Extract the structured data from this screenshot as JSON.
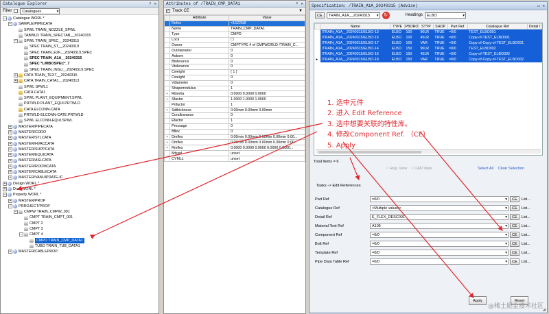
{
  "catalogue": {
    "title": "Catalogue Explorer",
    "filter_label": "Filter",
    "filter_value": "Catalogues",
    "nodes": [
      {
        "d": 0,
        "exp": "−",
        "icon": "world",
        "label": "Catalogue WORL *"
      },
      {
        "d": 1,
        "exp": "−",
        "icon": "world",
        "label": "SAMPLE/PIPECATA"
      },
      {
        "d": 2,
        "exp": "",
        "icon": "doc",
        "label": "SPWL TRAIN_NOZZLE_SPWL"
      },
      {
        "d": 2,
        "exp": "",
        "icon": "doc",
        "label": "TABWLD TRAIN_SPECTAB__20240315"
      },
      {
        "d": 2,
        "exp": "−",
        "icon": "doc",
        "label": "SPWL TRAIN_SPEC__20240315"
      },
      {
        "d": 3,
        "exp": "",
        "icon": "doc",
        "label": "SPEC TRAIN_ST__20240319"
      },
      {
        "d": 3,
        "exp": "",
        "icon": "doc",
        "label": "SPEC TRAIN_E2F__20240319.SPEC"
      },
      {
        "d": 3,
        "exp": "",
        "icon": "doc",
        "label": "SPEC TRAIN_A1A__20240315",
        "bold": true
      },
      {
        "d": 3,
        "exp": "",
        "icon": "doc",
        "label": "SPEC *LIMBOSPEC*_7",
        "bold": true
      },
      {
        "d": 3,
        "exp": "",
        "icon": "doc",
        "label": "SPEC TRAIN_INSU__20240319.SPEC"
      },
      {
        "d": 2,
        "exp": "+",
        "icon": "folder",
        "label": "CATA TRAIN_TEXT__20240315"
      },
      {
        "d": 2,
        "exp": "+",
        "icon": "folder",
        "label": "CATA TRAIN_CATA1__20240313"
      },
      {
        "d": 2,
        "exp": "",
        "icon": "doc",
        "label": "SPWL SPWL1"
      },
      {
        "d": 2,
        "exp": "",
        "icon": "folder",
        "label": "CATA CATA1"
      },
      {
        "d": 2,
        "exp": "",
        "icon": "doc",
        "label": "SPWL PLANT_EQUIPMENT.SPWL"
      },
      {
        "d": 2,
        "exp": "",
        "icon": "doc",
        "label": "PRTWLD PLANT_EQUI.PRTWLD"
      },
      {
        "d": 2,
        "exp": "",
        "icon": "folder",
        "label": "CATA ELCONN-CATA"
      },
      {
        "d": 2,
        "exp": "",
        "icon": "doc",
        "label": "PRTWLD ELCONN-CATE.PRTWLD"
      },
      {
        "d": 2,
        "exp": "",
        "icon": "doc",
        "label": "SPWL ELCONN-EQUI.SPWL"
      },
      {
        "d": 1,
        "exp": "+",
        "icon": "world",
        "label": "MASTER/PIPECATA"
      },
      {
        "d": 1,
        "exp": "+",
        "icon": "world",
        "label": "MASTER/CODO"
      },
      {
        "d": 1,
        "exp": "+",
        "icon": "world",
        "label": "MASTER/STLCATA"
      },
      {
        "d": 1,
        "exp": "+",
        "icon": "world",
        "label": "MASTER/HVACCATA"
      },
      {
        "d": 1,
        "exp": "+",
        "icon": "world",
        "label": "MASTER/SUPPCATA"
      },
      {
        "d": 1,
        "exp": "+",
        "icon": "world",
        "label": "MASTER/EQUICATA"
      },
      {
        "d": 1,
        "exp": "+",
        "icon": "world",
        "label": "MASTER/ASLCATA"
      },
      {
        "d": 1,
        "exp": "+",
        "icon": "world",
        "label": "MASTER/ROOMCATA"
      },
      {
        "d": 1,
        "exp": "+",
        "icon": "world",
        "label": "MASTER/CABLECATA"
      },
      {
        "d": 1,
        "exp": "+",
        "icon": "world",
        "label": "MASTER/VANUIPDATE-IC"
      },
      {
        "d": 0,
        "exp": "+",
        "icon": "world",
        "label": "Design WORL *"
      },
      {
        "d": 0,
        "exp": "+",
        "icon": "world",
        "label": "Draft WORL *"
      },
      {
        "d": 0,
        "exp": "−",
        "icon": "world",
        "label": "Property WORL *"
      },
      {
        "d": 1,
        "exp": "+",
        "icon": "world",
        "label": "MASTER/PROP"
      },
      {
        "d": 1,
        "exp": "−",
        "icon": "world",
        "label": "PRROJECT/PROP"
      },
      {
        "d": 2,
        "exp": "−",
        "icon": "doc",
        "label": "CMPW TRAIN_CMPW_001"
      },
      {
        "d": 3,
        "exp": "",
        "icon": "doc",
        "label": "CMPT TRAIN_CMPT_001"
      },
      {
        "d": 3,
        "exp": "",
        "icon": "doc",
        "label": "CMPT 2"
      },
      {
        "d": 3,
        "exp": "",
        "icon": "doc",
        "label": "CMPT 3"
      },
      {
        "d": 3,
        "exp": "−",
        "icon": "doc",
        "label": "CMPT 4"
      },
      {
        "d": 4,
        "exp": "",
        "icon": "doc",
        "label": "CMPD TRAIN_CMP_DATA1",
        "sel": true
      },
      {
        "d": 4,
        "exp": "",
        "icon": "doc",
        "label": "TUBD TRAIN_TUB_DATA1"
      },
      {
        "d": 1,
        "exp": "+",
        "icon": "world",
        "label": "MASTER/CABLEPROP"
      }
    ]
  },
  "attributes": {
    "title": "Attributes of /TRAIN_CMP_DATA1",
    "track_label": "Track CE",
    "col_attribute": "Attribute",
    "col_value": "Value",
    "rows": [
      {
        "exp": "",
        "a": "Refno",
        "v": "=15225/8",
        "sel": true
      },
      {
        "exp": "",
        "a": "Name",
        "v": "TRAIN_CMP_DATA1"
      },
      {
        "exp": "",
        "a": "Type",
        "v": "CMPD"
      },
      {
        "exp": "",
        "a": "Lock",
        "v": "☐"
      },
      {
        "exp": "",
        "a": "Owner",
        "v": "CMPTYPE 4 of CMPWORLD /TRAIN_C..."
      },
      {
        "exp": "",
        "a": "Outdiameter",
        "v": "0"
      },
      {
        "exp": "",
        "a": "Aobore",
        "v": "0"
      },
      {
        "exp": "",
        "a": "Btolerance",
        "v": "0"
      },
      {
        "exp": "",
        "a": "Vtolerance",
        "v": "0"
      },
      {
        "exp": "",
        "a": "Cweight",
        "v": "( 1 )"
      },
      {
        "exp": "",
        "a": "Cweight",
        "v": "0"
      },
      {
        "exp": "",
        "a": "Vdiameter",
        "v": "0"
      },
      {
        "exp": "",
        "a": "Shapemodulus",
        "v": "1"
      },
      {
        "exp": "+",
        "a": "Rinertia",
        "v": "0.0000 0.0000 0.0000"
      },
      {
        "exp": "+",
        "a": "Sfactor",
        "v": "1.0000 1.0000 1.0000"
      },
      {
        "exp": "",
        "a": "Pnfactor",
        "v": "1"
      },
      {
        "exp": "+",
        "a": "Sdthickness",
        "v": "0.00mm 0.00mm 0.00mm"
      },
      {
        "exp": "",
        "a": "Corallowance",
        "v": "0"
      },
      {
        "exp": "",
        "a": "Efactor",
        "v": "1"
      },
      {
        "exp": "",
        "a": "Pressage",
        "v": "0"
      },
      {
        "exp": "",
        "a": "Bflex",
        "v": "0"
      },
      {
        "exp": "+",
        "a": "Dmflex",
        "v": "0.00mm 0.00mm 0.00mm 0.00mm 0.00..."
      },
      {
        "exp": "+",
        "a": "Dmflex",
        "v": "0.00mm 0.00mm 0.00mm 0.00mm 0.00..."
      },
      {
        "exp": "+",
        "a": "Rmflex",
        "v": "0.0000 0.0000 0.0000 0.0000 0.0000..."
      },
      {
        "exp": "",
        "a": "Mtxref",
        "v": "unset"
      },
      {
        "exp": "",
        "a": "CYMLL",
        "v": "unset"
      }
    ]
  },
  "spec": {
    "title": "Specification: /TRAIN_A1A_20240315 (Advise)",
    "ce_label": "CE",
    "spec_value": "TRAIN_A1A__20240315",
    "headings_label": "Headings",
    "headings_value": "ELBO",
    "columns": [
      "Name",
      "TYPE",
      "PBORO",
      "STYP",
      "SHOP",
      "Part Ref",
      "Catalogue Ref",
      "Detail I"
    ],
    "rows": [
      [
        "/TRAIN_A1A__20240315/ELBO-13",
        "ELBO",
        "100",
        "90LR",
        "TRUE",
        "=0/0",
        "TEST_ELBO001",
        ""
      ],
      [
        "/TRAIN_A1A__20240315/ELBO-15",
        "ELBO",
        "100",
        "45LR",
        "TRUE",
        "=0/0",
        "Copy-of-TEST_ELBO001",
        ""
      ],
      [
        "/TRAIN_A1A__20240315/ELBO-17",
        "ELBO",
        "100",
        "VAR",
        "TRUE",
        "=0/0",
        "Copy-of-Copy-of-TEST_ELBO001",
        ""
      ],
      [
        "/TRAIN_A1A__20240315/ELBO-14",
        "ELBO",
        "150",
        "90LR",
        "TRUE",
        "=0/0",
        "TEST_ELBO002",
        ""
      ],
      [
        "/TRAIN_A1A__20240315/ELBO-16",
        "ELBO",
        "150",
        "45LR",
        "TRUE",
        "=0/0",
        "Copy-of-TEST_ELBO002",
        ""
      ],
      [
        "/TRAIN_A1A__20240315/ELBO-18",
        "ELBO",
        "150",
        "VAR",
        "TRUE",
        "=0/0",
        "Copy-of-Copy-of-TEST_ELBO002",
        ""
      ]
    ],
    "total_items": "Total Items = 6",
    "reg_view": "Reg. View",
    "cad_view": "CAD View",
    "select_all": "Select All",
    "clear_selection": "Clear Selection",
    "tasks_label": "Tasks -> Edit References",
    "refs": [
      {
        "label": "Part Ref",
        "value": "=0/0"
      },
      {
        "label": "Catalogue Ref",
        "value": "<Multiple values>"
      },
      {
        "label": "Detail Ref",
        "value": "E_FLEX_DESC001"
      },
      {
        "label": "Material Text Ref",
        "value": "A105"
      },
      {
        "label": "Component Ref",
        "value": "=0/0"
      },
      {
        "label": "Bolt Ref",
        "value": "=0/0"
      },
      {
        "label": "Template Ref",
        "value": "=0/0"
      },
      {
        "label": "Pipe Data Table Ref",
        "value": "=0/0"
      }
    ],
    "ce_btn": "CE",
    "list_btn": "List...",
    "apply": "Apply",
    "reset": "Reset"
  },
  "annotation": {
    "lines": [
      "1. 选中元件",
      "2. 进入 Edit Reference",
      "3. 选中想要关联的特性库。",
      "4. 修改Component Ref. （CE）",
      "5. Apply"
    ],
    "color": "#e0262c"
  },
  "watermark": "@稀土掘金技术社区"
}
